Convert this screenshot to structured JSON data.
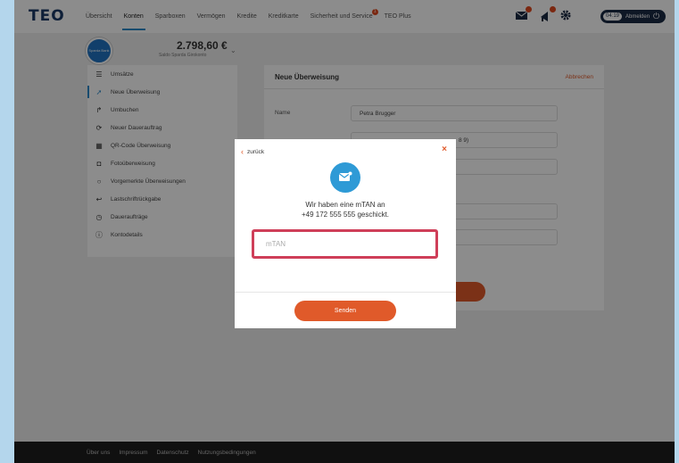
{
  "brand": {
    "logo_text": "TEO",
    "accent": "#2c89c8",
    "orange": "#e05a2a"
  },
  "nav": {
    "items": [
      "Übersicht",
      "Konten",
      "Sparboxen",
      "Vermögen",
      "Kredite",
      "Kreditkarte",
      "Sicherheit und Service",
      "TEO Plus"
    ],
    "active": "Konten",
    "badge": "1"
  },
  "session": {
    "timer": "04:19",
    "logout_label": "Abmelden"
  },
  "account": {
    "bank_label": "Sparda Bank",
    "balance": "2.798,60 €",
    "subtitle": "Saldo Sparda Girokonto"
  },
  "sidebar": {
    "items": [
      {
        "label": "Umsätze",
        "icon": "list-icon"
      },
      {
        "label": "Neue Überweisung",
        "icon": "arrow-icon"
      },
      {
        "label": "Umbuchen",
        "icon": "rebook-icon"
      },
      {
        "label": "Neuer Dauerauftrag",
        "icon": "repeat-icon"
      },
      {
        "label": "QR-Code Überweisung",
        "icon": "qr-icon"
      },
      {
        "label": "Fotoüberweisung",
        "icon": "camera-icon"
      },
      {
        "label": "Vorgemerkte Überweisungen",
        "icon": "circle-icon"
      },
      {
        "label": "Lastschriftrückgabe",
        "icon": "return-icon"
      },
      {
        "label": "Daueraufträge",
        "icon": "clock-icon"
      },
      {
        "label": "Kontodetails",
        "icon": "info-icon"
      }
    ]
  },
  "panel": {
    "title": "Neue Überweisung",
    "cancel": "Abbrechen",
    "name_label": "Name",
    "name_value": "Petra Brugger",
    "iban_value": "8 9)"
  },
  "modal": {
    "back": "zurück",
    "message_line1": "Wir haben eine mTAN an",
    "message_line2": "+49 172 555 555 geschickt.",
    "mtan_placeholder": "mTAN",
    "send": "Senden"
  },
  "footer": {
    "links": [
      "Über uns",
      "Impressum",
      "Datenschutz",
      "Nutzungsbedingungen"
    ]
  }
}
